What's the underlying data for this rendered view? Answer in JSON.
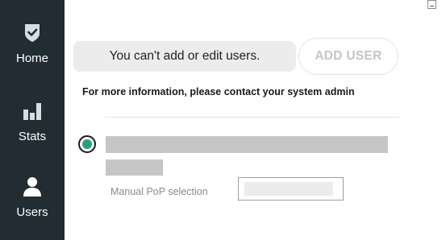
{
  "sidebar": {
    "items": [
      {
        "id": "home",
        "label": "Home",
        "icon": "shield-check-icon"
      },
      {
        "id": "stats",
        "label": "Stats",
        "icon": "bar-chart-icon"
      },
      {
        "id": "users",
        "label": "Users",
        "icon": "user-icon"
      }
    ]
  },
  "window": {
    "minimize_icon": "minimize-icon"
  },
  "main": {
    "notice": "You can't add or edit users.",
    "add_user_label": "ADD USER",
    "info_text": "For more information, please contact your system admin",
    "pop_selection": {
      "selected": true,
      "label": "Manual PoP selection",
      "value": ""
    }
  },
  "colors": {
    "sidebar_bg": "#222c33",
    "accent": "#2aa07a",
    "redacted": "#c6c6c6"
  }
}
